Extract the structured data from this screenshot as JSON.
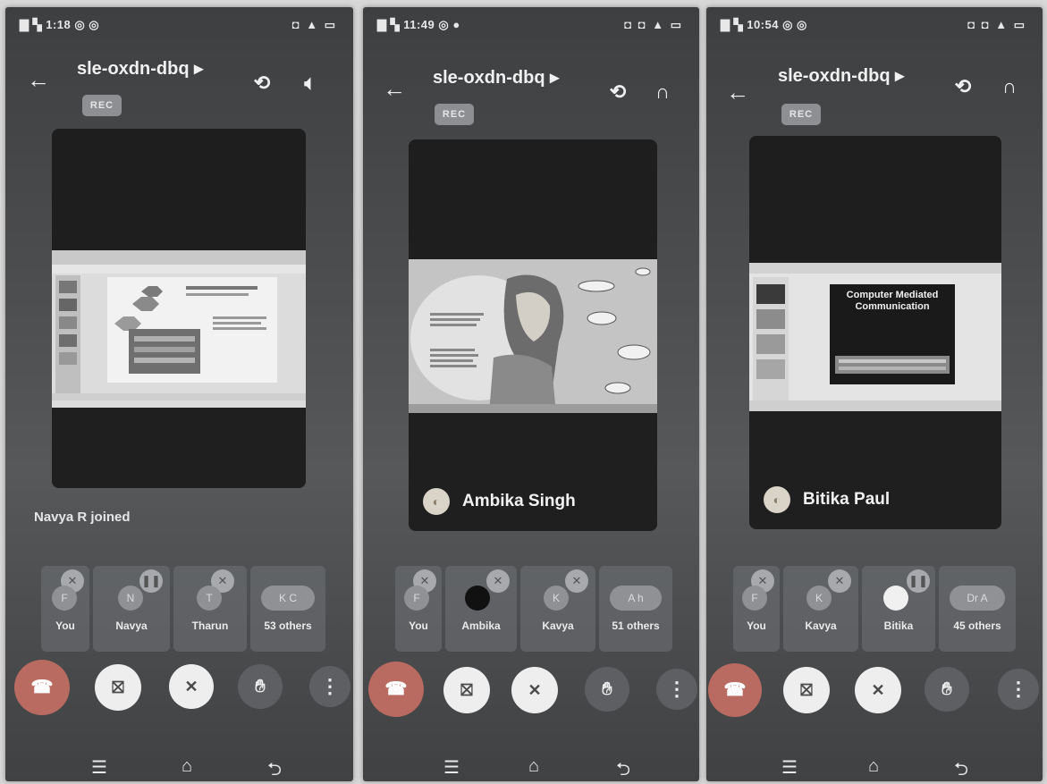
{
  "meeting_code": "sle-oxdn-dbq ▸",
  "rec_label": "REC",
  "screens": [
    {
      "status_time": "1:18",
      "status_left": "▇ ▚ 1:18 ◎ ◎",
      "status_right": "◘ ▲ ▭",
      "right_icon_1": "camera-flip-icon",
      "right_icon_2": "speaker-icon",
      "toast": "Navya R joined",
      "presenter": "",
      "participants": [
        {
          "initial": "F",
          "label": "You",
          "mic": "muted"
        },
        {
          "initial": "N",
          "label": "Navya",
          "mic": "speaking"
        },
        {
          "initial": "T",
          "label": "Tharun",
          "mic": "muted"
        },
        {
          "initial": "K C",
          "label": "53 others",
          "mic": "none"
        }
      ]
    },
    {
      "status_time": "11:49",
      "status_left": "▇ ▚ 11:49 ◎ ●",
      "status_right": "◘ ◘ ▲ ▭",
      "right_icon_1": "camera-flip-icon",
      "right_icon_2": "headphones-icon",
      "toast": "",
      "presenter": "Ambika Singh",
      "participants": [
        {
          "initial": "F",
          "label": "You",
          "mic": "muted"
        },
        {
          "initial": "",
          "label": "Ambika",
          "mic": "muted"
        },
        {
          "initial": "K",
          "label": "Kavya",
          "mic": "muted"
        },
        {
          "initial": "A h",
          "label": "51 others",
          "mic": "none"
        }
      ]
    },
    {
      "status_time": "10:54",
      "status_left": "▇ ▚ 10:54 ◎ ◎",
      "status_right": "◘ ◘ ▲ ▭",
      "right_icon_1": "camera-flip-icon",
      "right_icon_2": "headphones-icon",
      "toast": "",
      "presenter": "Bitika Paul",
      "slide_title": "Computer Mediated Communication",
      "participants": [
        {
          "initial": "F",
          "label": "You",
          "mic": "muted"
        },
        {
          "initial": "K",
          "label": "Kavya",
          "mic": "muted"
        },
        {
          "initial": "",
          "label": "Bitika",
          "mic": "speaking"
        },
        {
          "initial": "Dr A",
          "label": "45 others",
          "mic": "none"
        }
      ]
    }
  ],
  "controls": {
    "end_call": "end-call-icon",
    "camera": "camera-off-icon",
    "mic": "mic-off-icon",
    "raise_hand": "raise-hand-icon",
    "more": "more-vert-icon"
  },
  "navbar": {
    "menu": "☰",
    "home": "⌂",
    "back": "⮌"
  },
  "colors": {
    "end_call": "#b96a61",
    "control_white": "#eeeeee",
    "background": "#4a4b4d"
  }
}
